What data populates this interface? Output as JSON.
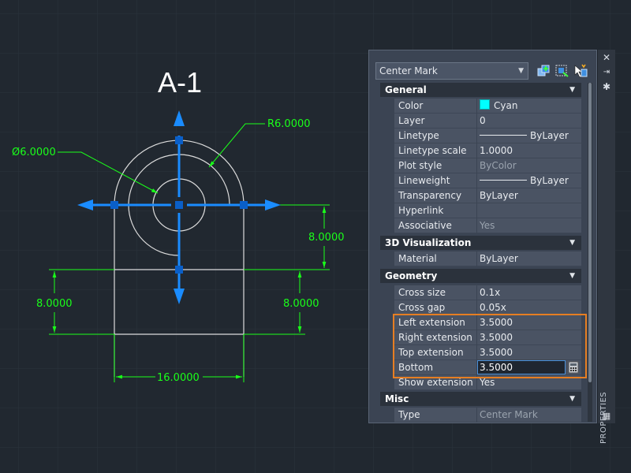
{
  "drawing": {
    "title": "A-1",
    "dims": {
      "radius": "R6.0000",
      "diameter": "Ø6.0000",
      "right_height": "8.0000",
      "left_leg": "8.0000",
      "right_leg": "8.0000",
      "width": "16.0000"
    },
    "colors": {
      "background": "#212830",
      "geometry": "#dcdcdc",
      "dimension": "#1aff1a",
      "centermark": "#1a8cff"
    }
  },
  "properties": {
    "selection": "Center Mark",
    "toolbar_icons": [
      "add-selected-icon",
      "quick-select-icon",
      "toggle-pickadd-icon"
    ],
    "side_controls": [
      "close-icon",
      "auto-hide-icon",
      "settings-icon"
    ],
    "panel_title": "PROPERTIES",
    "categories": [
      {
        "name": "General",
        "rows": [
          {
            "k": "Color",
            "v": "Cyan",
            "type": "color",
            "swatch": "#00ffff"
          },
          {
            "k": "Layer",
            "v": "0"
          },
          {
            "k": "Linetype",
            "v": "ByLayer",
            "type": "line"
          },
          {
            "k": "Linetype scale",
            "v": "1.0000"
          },
          {
            "k": "Plot style",
            "v": "ByColor",
            "dim": true
          },
          {
            "k": "Lineweight",
            "v": "ByLayer",
            "type": "line"
          },
          {
            "k": "Transparency",
            "v": "ByLayer"
          },
          {
            "k": "Hyperlink",
            "v": ""
          },
          {
            "k": "Associative",
            "v": "Yes",
            "dim": true
          }
        ]
      },
      {
        "name": "3D Visualization",
        "rows": [
          {
            "k": "Material",
            "v": "ByLayer"
          }
        ]
      },
      {
        "name": "Geometry",
        "rows": [
          {
            "k": "Cross size",
            "v": "0.1x"
          },
          {
            "k": "Cross gap",
            "v": "0.05x"
          },
          {
            "k": "Left extension",
            "v": "3.5000"
          },
          {
            "k": "Right extension",
            "v": "3.5000"
          },
          {
            "k": "Top extension",
            "v": "3.5000"
          },
          {
            "k": "Bottom extension",
            "v": "3.5000",
            "editing": true
          },
          {
            "k": "Show extension",
            "v": "Yes"
          }
        ]
      },
      {
        "name": "Misc",
        "rows": [
          {
            "k": "Type",
            "v": "Center Mark",
            "dim": true
          }
        ]
      }
    ]
  }
}
